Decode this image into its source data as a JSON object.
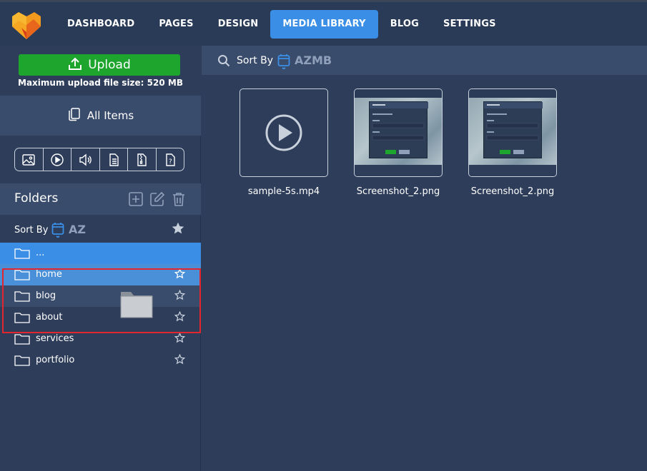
{
  "nav": {
    "items": [
      {
        "label": "DASHBOARD",
        "active": false
      },
      {
        "label": "PAGES",
        "active": false
      },
      {
        "label": "DESIGN",
        "active": false
      },
      {
        "label": "MEDIA LIBRARY",
        "active": true
      },
      {
        "label": "BLOG",
        "active": false
      },
      {
        "label": "SETTINGS",
        "active": false
      }
    ]
  },
  "sidebar": {
    "upload_label": "Upload",
    "upload_note": "Maximum upload file size: 520 MB",
    "all_items_label": "All Items",
    "type_filters": [
      "image-icon",
      "video-icon",
      "audio-icon",
      "document-icon",
      "archive-icon",
      "unknown-file-icon"
    ],
    "folders_title": "Folders",
    "sort_label": "Sort By",
    "sort_az": "AZ",
    "folders": [
      {
        "name": "...",
        "starred": false
      },
      {
        "name": "home",
        "starred": false
      },
      {
        "name": "blog",
        "starred": false
      },
      {
        "name": "about",
        "starred": false
      },
      {
        "name": "services",
        "starred": false
      },
      {
        "name": "portfolio",
        "starred": false
      }
    ]
  },
  "main": {
    "sort_label": "Sort By",
    "sort_az": "AZ",
    "sort_mb": "MB",
    "files": [
      {
        "name": "sample-5s.mp4",
        "kind": "video"
      },
      {
        "name": "Screenshot_2.png",
        "kind": "image"
      },
      {
        "name": "Screenshot_2.png",
        "kind": "image"
      }
    ]
  },
  "colors": {
    "accent": "#3a8ee6",
    "upload_green": "#1ea52e",
    "bg": "#2d3d5a",
    "panel": "#3a4c6c",
    "selection_outline": "#e3262e"
  }
}
